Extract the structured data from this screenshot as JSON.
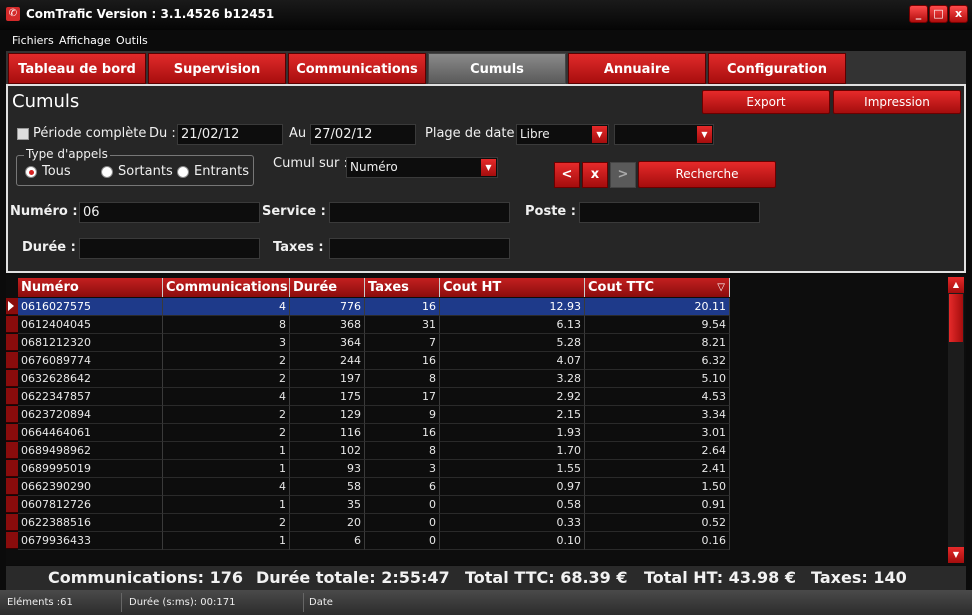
{
  "window": {
    "title": "ComTrafic  Version : 3.1.4526  b12451",
    "icon": "phone-icon",
    "buttons": {
      "minimize": "_",
      "maximize": "□",
      "close": "x"
    }
  },
  "menu": [
    "Fichiers",
    "Affichage",
    "Outils"
  ],
  "tabs": [
    {
      "label": "Tableau de bord",
      "active": false
    },
    {
      "label": "Supervision",
      "active": false
    },
    {
      "label": "Communications",
      "active": false
    },
    {
      "label": "Cumuls",
      "active": true
    },
    {
      "label": "Annuaire",
      "active": false
    },
    {
      "label": "Configuration",
      "active": false
    }
  ],
  "panel": {
    "title": "Cumuls",
    "export_label": "Export",
    "print_label": "Impression",
    "periode_complete_label": "Période complète",
    "du_label": "Du :",
    "du_value": "21/02/12",
    "au_label": "Au",
    "au_value": "27/02/12",
    "plage_label": "Plage de date",
    "plage_value": "Libre",
    "plage2_value": "",
    "type_appels_label": "Type d'appels",
    "radio_tous": "Tous",
    "radio_sortants": "Sortants",
    "radio_entrants": "Entrants",
    "selected_type": "Tous",
    "cumul_label": "Cumul sur :",
    "cumul_value": "Numéro",
    "prev_label": "<",
    "clear_label": "x",
    "next_label": ">",
    "search_label": "Recherche",
    "numero_label": "Numéro :",
    "numero_value": "06",
    "service_label": "Service :",
    "service_value": "",
    "poste_label": "Poste :",
    "poste_value": "",
    "duree_label": "Durée :",
    "duree_value": "",
    "taxes_label": "Taxes :",
    "taxes_value": ""
  },
  "grid": {
    "columns": [
      "Numéro",
      "Communications",
      "Durée",
      "Taxes",
      "Cout HT",
      "Cout TTC"
    ],
    "sort_indicator": "▽",
    "rows": [
      [
        "0616027575",
        "4",
        "776",
        "16",
        "12.93",
        "20.11"
      ],
      [
        "0612404045",
        "8",
        "368",
        "31",
        "6.13",
        "9.54"
      ],
      [
        "0681212320",
        "3",
        "364",
        "7",
        "5.28",
        "8.21"
      ],
      [
        "0676089774",
        "2",
        "244",
        "16",
        "4.07",
        "6.32"
      ],
      [
        "0632628642",
        "2",
        "197",
        "8",
        "3.28",
        "5.10"
      ],
      [
        "0622347857",
        "4",
        "175",
        "17",
        "2.92",
        "4.53"
      ],
      [
        "0623720894",
        "2",
        "129",
        "9",
        "2.15",
        "3.34"
      ],
      [
        "0664464061",
        "2",
        "116",
        "16",
        "1.93",
        "3.01"
      ],
      [
        "0689498962",
        "1",
        "102",
        "8",
        "1.70",
        "2.64"
      ],
      [
        "0689995019",
        "1",
        "93",
        "3",
        "1.55",
        "2.41"
      ],
      [
        "0662390290",
        "4",
        "58",
        "6",
        "0.97",
        "1.50"
      ],
      [
        "0607812726",
        "1",
        "35",
        "0",
        "0.58",
        "0.91"
      ],
      [
        "0622388516",
        "2",
        "20",
        "0",
        "0.33",
        "0.52"
      ],
      [
        "0679936433",
        "1",
        "6",
        "0",
        "0.10",
        "0.16"
      ]
    ],
    "selected_row": 0
  },
  "summary": {
    "communications": "Communications: 176",
    "duree": "Durée totale: 2:55:47",
    "ttc": "Total TTC: 68.39 €",
    "ht": "Total HT: 43.98 €",
    "taxes": "Taxes: 140"
  },
  "status": {
    "elements": "Eléments :61",
    "duree": "Durée (s:ms): 00:171",
    "date": "Date"
  },
  "colors": {
    "accent": "#d42020",
    "selected_row": "#1e3a8a",
    "background": "#262626"
  }
}
